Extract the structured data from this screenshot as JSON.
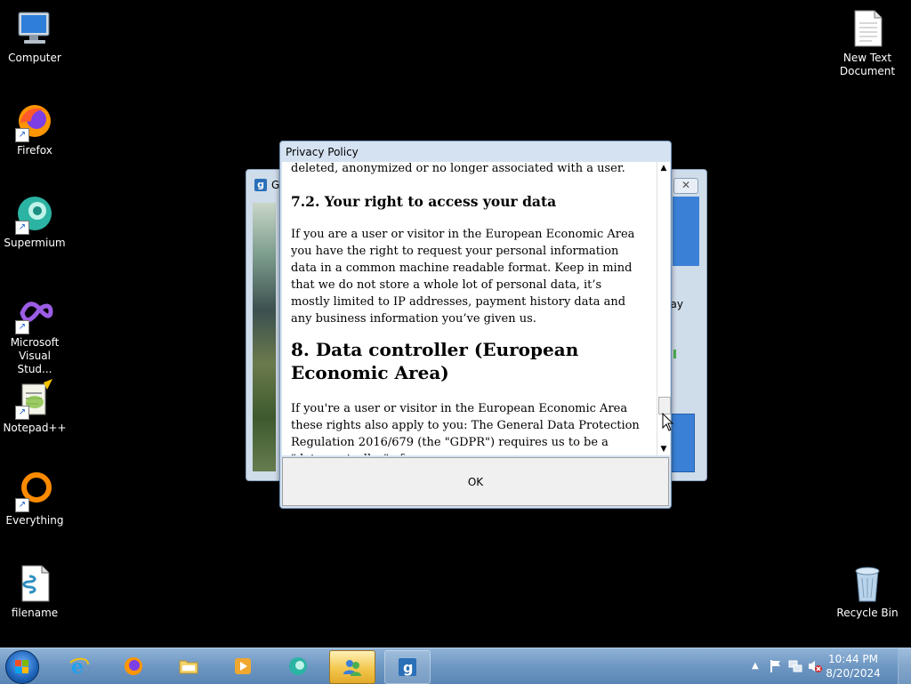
{
  "desktop": {
    "icons_left": [
      {
        "label": "Computer",
        "icon": "computer-icon"
      },
      {
        "label": "Firefox",
        "icon": "firefox-icon"
      },
      {
        "label": "Supermium",
        "icon": "supermium-icon"
      },
      {
        "label": "Microsoft Visual Stud...",
        "icon": "visual-studio-icon"
      },
      {
        "label": "Notepad++",
        "icon": "notepadpp-icon"
      },
      {
        "label": "Everything",
        "icon": "everything-icon"
      },
      {
        "label": "filename",
        "icon": "script-file-icon"
      }
    ],
    "icons_right": [
      {
        "label": "New Text Document",
        "icon": "text-document-icon"
      },
      {
        "label": "Recycle Bin",
        "icon": "recycle-bin-icon"
      }
    ]
  },
  "back_window": {
    "title_fragment": "G",
    "partial_text": "ay"
  },
  "dialog": {
    "title": "Privacy Policy",
    "content": {
      "lead_text": "deleted, anonymized or no longer associated with a user.",
      "heading_72": "7.2. Your right to access your data",
      "para_72": "If you are a user or visitor in the European Economic Area you have the right to request your personal information data in a common machine readable format. Keep in mind that we do not store a whole lot of personal data, it’s mostly limited to IP addresses, payment history data and any business information you’ve given us.",
      "heading_8": "8. Data controller (European Economic Area)",
      "para_8": "If you're a user or visitor in the European Economic Area these rights also apply to you: The General Data Protection Regulation 2016/679 (the \"GDPR\") requires us to be a \"data controller\" of"
    },
    "ok_label": "OK"
  },
  "taskbar": {
    "pinned": [
      "internet-explorer-icon",
      "firefox-icon",
      "file-explorer-icon",
      "media-player-icon",
      "supermium-icon",
      "users-app-icon",
      "g-app-icon"
    ],
    "active_app": "users-app-icon",
    "clock": {
      "time": "10:44 PM",
      "date": "8/20/2024"
    }
  },
  "colors": {
    "desktop_bg": "#000000",
    "taskbar_blue": "#6e97c2",
    "dialog_frame": "#d4e2f1"
  }
}
